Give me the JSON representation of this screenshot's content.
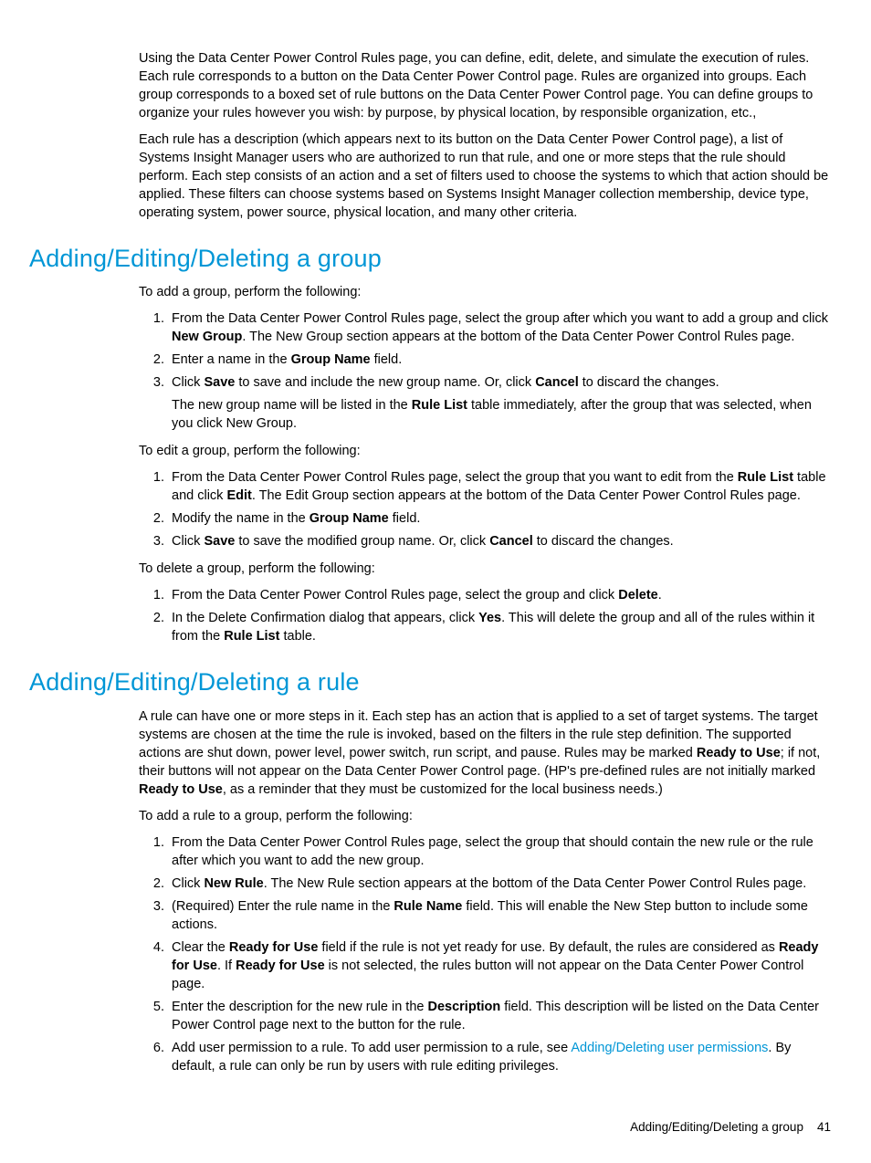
{
  "intro": {
    "p1": "Using the Data Center Power Control Rules page, you can define, edit, delete, and simulate the execution of rules. Each rule corresponds to a button on the Data Center Power Control page. Rules are organized into groups. Each group corresponds to a boxed set of rule buttons on the Data Center Power Control page. You can define groups to organize your rules however you wish: by purpose, by physical location, by responsible organization, etc.,",
    "p2": "Each rule has a description (which appears next to its button on the Data Center Power Control page), a list of Systems Insight Manager users who are authorized to run that rule, and one or more steps that the rule should perform. Each step consists of an action and a set of filters used to choose the systems to which that action should be applied. These filters can choose systems based on Systems Insight Manager collection membership, device type, operating system, power source, physical location, and many other criteria."
  },
  "s1": {
    "heading": "Adding/Editing/Deleting a group",
    "add_intro": "To add a group, perform the following:",
    "add_li1_a": "From the Data Center Power Control Rules page, select the group after which you want to add a group and click ",
    "add_li1_bold": "New Group",
    "add_li1_b": ". The New Group section appears at the bottom of the Data Center Power Control Rules page.",
    "add_li2_a": "Enter a name in the ",
    "add_li2_bold": "Group Name",
    "add_li2_b": " field.",
    "add_li3_a": "Click ",
    "add_li3_bold1": "Save",
    "add_li3_b": " to save and include the new group name. Or, click ",
    "add_li3_bold2": "Cancel",
    "add_li3_c": " to discard the changes.",
    "add_li3_sub_a": "The new group name will be listed in the ",
    "add_li3_sub_bold": "Rule List",
    "add_li3_sub_b": " table immediately, after the group that was selected, when you click New Group.",
    "edit_intro": "To edit a group, perform the following:",
    "edit_li1_a": "From the Data Center Power Control Rules page, select the group that you want to edit from the ",
    "edit_li1_bold1": "Rule List",
    "edit_li1_b": " table and click ",
    "edit_li1_bold2": "Edit",
    "edit_li1_c": ". The Edit Group section appears at the bottom of the Data Center Power Control Rules page.",
    "edit_li2_a": "Modify the name in the ",
    "edit_li2_bold": "Group Name",
    "edit_li2_b": " field.",
    "edit_li3_a": "Click ",
    "edit_li3_bold1": "Save",
    "edit_li3_b": " to save the modified group name. Or, click ",
    "edit_li3_bold2": "Cancel",
    "edit_li3_c": " to discard the changes.",
    "del_intro": "To delete a group, perform the following:",
    "del_li1_a": "From the Data Center Power Control Rules page, select the group and click ",
    "del_li1_bold": "Delete",
    "del_li1_b": ".",
    "del_li2_a": "In the Delete Confirmation dialog that appears, click ",
    "del_li2_bold1": "Yes",
    "del_li2_b": ". This will delete the group and all of the rules within it from the ",
    "del_li2_bold2": "Rule List",
    "del_li2_c": " table."
  },
  "s2": {
    "heading": "Adding/Editing/Deleting a rule",
    "p1_a": "A rule can have one or more steps in it. Each step has an action that is applied to a set of target systems. The target systems are chosen at the time the rule is invoked, based on the filters in the rule step definition. The supported actions are shut down, power level, power switch, run script, and pause. Rules may be marked ",
    "p1_bold1": "Ready to Use",
    "p1_b": "; if not, their buttons will not appear on the Data Center Power Control page. (HP's pre-defined rules are not initially marked ",
    "p1_bold2": "Ready to Use",
    "p1_c": ", as a reminder that they must be customized for the local business needs.)",
    "add_intro": "To add a rule to a group, perform the following:",
    "li1": "From the Data Center Power Control Rules page, select the group that should contain the new rule or the rule after which you want to add the new group.",
    "li2_a": "Click ",
    "li2_bold": "New Rule",
    "li2_b": ". The New Rule section appears at the bottom of the Data Center Power Control Rules page.",
    "li3_a": "(Required) Enter the rule name in the ",
    "li3_bold": "Rule Name",
    "li3_b": " field. This will enable the New Step button to include some actions.",
    "li4_a": "Clear the ",
    "li4_bold1": "Ready for Use",
    "li4_b": " field if the rule is not yet ready for use. By default, the rules are considered as ",
    "li4_bold2": "Ready for Use",
    "li4_c": ". If ",
    "li4_bold3": "Ready for Use",
    "li4_d": " is not selected, the rules button will not appear on the Data Center Power Control page.",
    "li5_a": "Enter the description for the new rule in the ",
    "li5_bold": "Description",
    "li5_b": " field. This description will be listed on the Data Center Power Control page next to the button for the rule.",
    "li6_a": "Add user permission to a rule. To add user permission to a rule, see ",
    "li6_link": "Adding/Deleting user permissions",
    "li6_b": ". By default, a rule can only be run by users with rule editing privileges."
  },
  "footer": {
    "text": "Adding/Editing/Deleting a group",
    "page": "41"
  }
}
